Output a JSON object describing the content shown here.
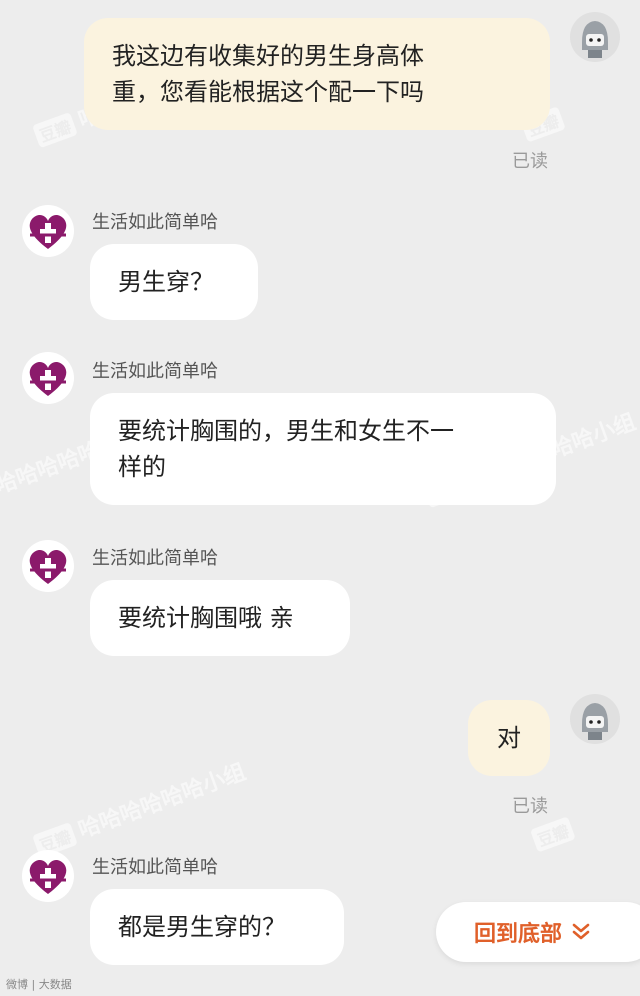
{
  "messages": [
    {
      "from": "self",
      "text_lines": [
        "我这边有收集好的男生身高体",
        "重，您看能根据这个配一下吗"
      ],
      "status": "已读"
    },
    {
      "from": "shop",
      "sender": "生活如此简单哈",
      "text_lines": [
        "男生穿？"
      ]
    },
    {
      "from": "shop",
      "sender": "生活如此简单哈",
      "text_lines": [
        "要统计胸围的，男生和女生不一",
        "样的"
      ]
    },
    {
      "from": "shop",
      "sender": "生活如此简单哈",
      "text_lines": [
        "要统计胸围哦 亲"
      ]
    },
    {
      "from": "self",
      "text_lines": [
        "对"
      ],
      "status": "已读"
    },
    {
      "from": "shop",
      "sender": "生活如此简单哈",
      "text_lines": [
        "都是男生穿的？"
      ]
    }
  ],
  "back_to_bottom": {
    "label": "回到底部",
    "icon": "double-chevron-down-icon",
    "color": "#e0602a"
  },
  "watermark": {
    "badge": "豆瓣",
    "text": "哈哈哈哈哈哈小组"
  },
  "corner_watermark": "微博 | 大数据",
  "colors": {
    "background": "#ededed",
    "self_bubble": "#fbf3df",
    "shop_bubble": "#ffffff",
    "shop_logo": "#8b1a6b"
  }
}
